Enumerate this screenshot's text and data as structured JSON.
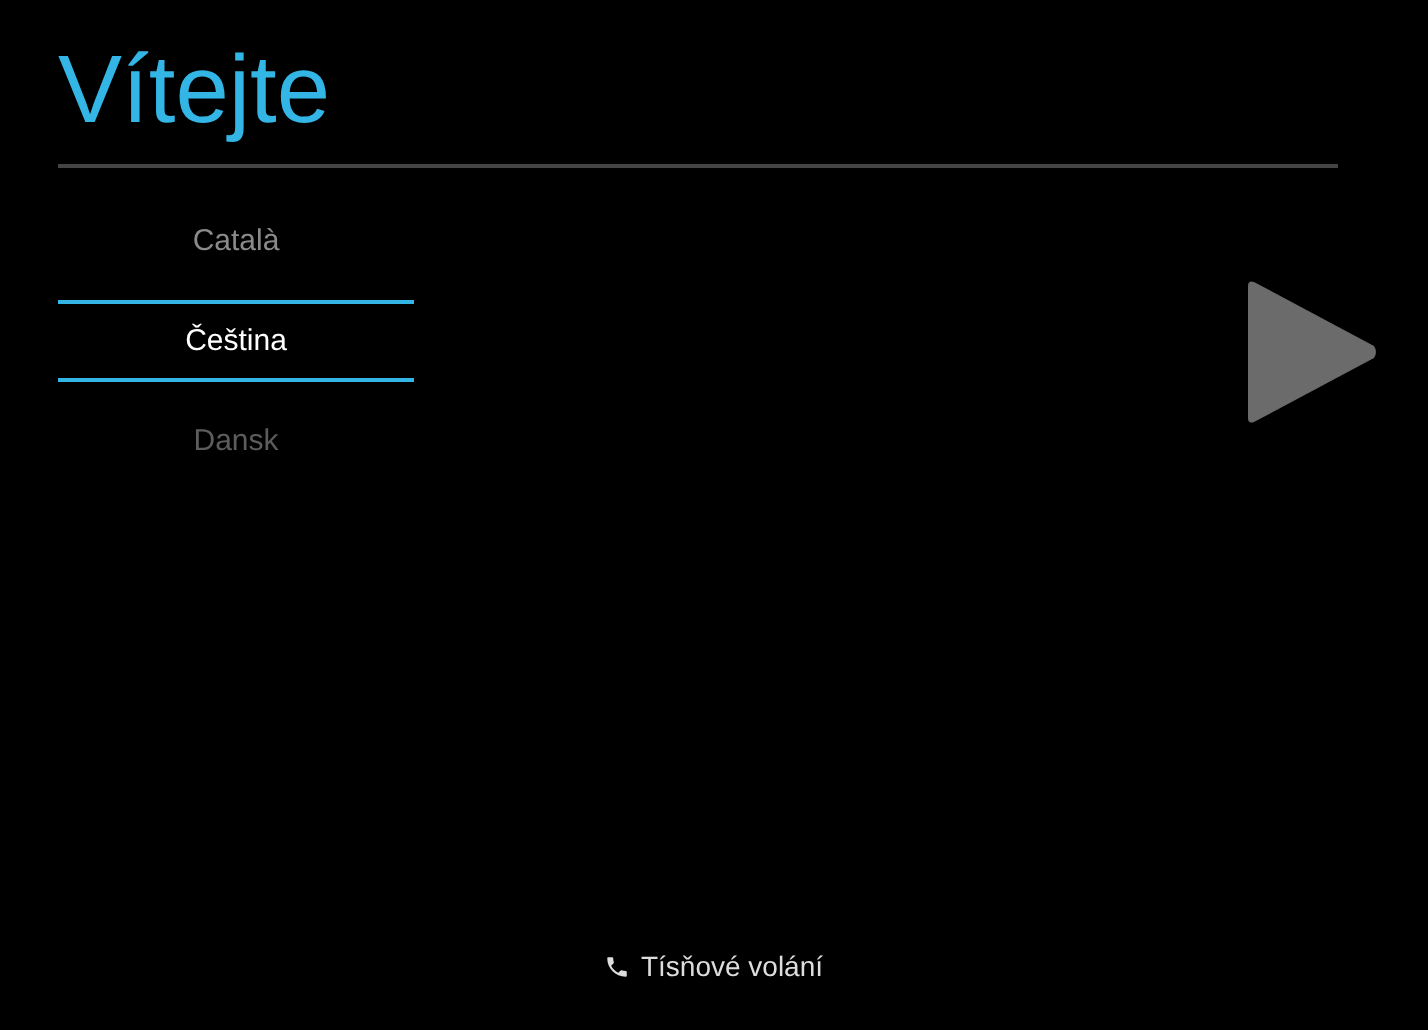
{
  "title": "Vítejte",
  "languages": [
    {
      "label": "Català",
      "selected": false
    },
    {
      "label": "Čeština",
      "selected": true
    },
    {
      "label": "Dansk",
      "selected": false
    }
  ],
  "emergency_call": {
    "label": "Tísňové volání"
  }
}
